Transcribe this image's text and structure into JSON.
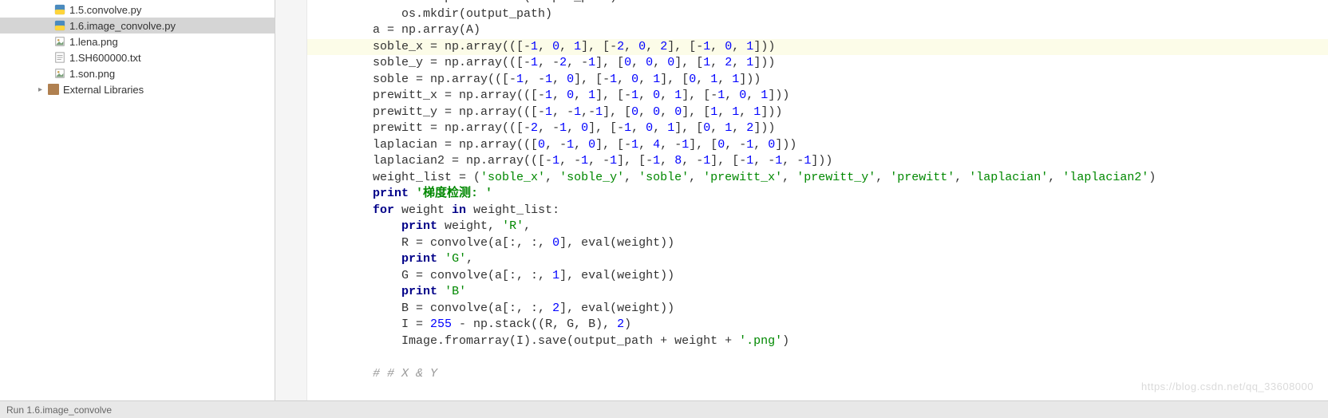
{
  "sidebar": {
    "files": [
      {
        "name": "1.5.convolve.py",
        "type": "py"
      },
      {
        "name": "1.6.image_convolve.py",
        "type": "py",
        "selected": true
      },
      {
        "name": "1.lena.png",
        "type": "img"
      },
      {
        "name": "1.SH600000.txt",
        "type": "txt"
      },
      {
        "name": "1.son.png",
        "type": "img"
      }
    ],
    "external_libraries_label": "External Libraries"
  },
  "code": {
    "lines": [
      {
        "indent": 2,
        "tokens": [
          {
            "t": "if",
            "c": "kw"
          },
          {
            "t": " "
          },
          {
            "t": "not",
            "c": "kw"
          },
          {
            "t": " os.path.exists(output_path):"
          }
        ],
        "cut_top": true
      },
      {
        "indent": 3,
        "tokens": [
          {
            "t": "os.mkdir(output_path)"
          }
        ]
      },
      {
        "indent": 2,
        "tokens": [
          {
            "t": "a = np.array(A)"
          }
        ]
      },
      {
        "indent": 2,
        "highlight": true,
        "tokens": [
          {
            "t": "soble_x = np.array(([-"
          },
          {
            "t": "1",
            "c": "num"
          },
          {
            "t": ", "
          },
          {
            "t": "0",
            "c": "num"
          },
          {
            "t": ", "
          },
          {
            "t": "1",
            "c": "num"
          },
          {
            "t": "], [-"
          },
          {
            "t": "2",
            "c": "num"
          },
          {
            "t": ", "
          },
          {
            "t": "0",
            "c": "num"
          },
          {
            "t": ", "
          },
          {
            "t": "2",
            "c": "num"
          },
          {
            "t": "], [-"
          },
          {
            "t": "1",
            "c": "num"
          },
          {
            "t": ", "
          },
          {
            "t": "0",
            "c": "num"
          },
          {
            "t": ", "
          },
          {
            "t": "1",
            "c": "num"
          },
          {
            "t": "]))"
          }
        ]
      },
      {
        "indent": 2,
        "tokens": [
          {
            "t": "soble_y = np.array(([-"
          },
          {
            "t": "1",
            "c": "num"
          },
          {
            "t": ", -"
          },
          {
            "t": "2",
            "c": "num"
          },
          {
            "t": ", -"
          },
          {
            "t": "1",
            "c": "num"
          },
          {
            "t": "], ["
          },
          {
            "t": "0",
            "c": "num"
          },
          {
            "t": ", "
          },
          {
            "t": "0",
            "c": "num"
          },
          {
            "t": ", "
          },
          {
            "t": "0",
            "c": "num"
          },
          {
            "t": "], ["
          },
          {
            "t": "1",
            "c": "num"
          },
          {
            "t": ", "
          },
          {
            "t": "2",
            "c": "num"
          },
          {
            "t": ", "
          },
          {
            "t": "1",
            "c": "num"
          },
          {
            "t": "]))"
          }
        ]
      },
      {
        "indent": 2,
        "tokens": [
          {
            "t": "soble = np.array(([-"
          },
          {
            "t": "1",
            "c": "num"
          },
          {
            "t": ", -"
          },
          {
            "t": "1",
            "c": "num"
          },
          {
            "t": ", "
          },
          {
            "t": "0",
            "c": "num"
          },
          {
            "t": "], [-"
          },
          {
            "t": "1",
            "c": "num"
          },
          {
            "t": ", "
          },
          {
            "t": "0",
            "c": "num"
          },
          {
            "t": ", "
          },
          {
            "t": "1",
            "c": "num"
          },
          {
            "t": "], ["
          },
          {
            "t": "0",
            "c": "num"
          },
          {
            "t": ", "
          },
          {
            "t": "1",
            "c": "num"
          },
          {
            "t": ", "
          },
          {
            "t": "1",
            "c": "num"
          },
          {
            "t": "]))"
          }
        ]
      },
      {
        "indent": 2,
        "tokens": [
          {
            "t": "prewitt_x = np.array(([-"
          },
          {
            "t": "1",
            "c": "num"
          },
          {
            "t": ", "
          },
          {
            "t": "0",
            "c": "num"
          },
          {
            "t": ", "
          },
          {
            "t": "1",
            "c": "num"
          },
          {
            "t": "], [-"
          },
          {
            "t": "1",
            "c": "num"
          },
          {
            "t": ", "
          },
          {
            "t": "0",
            "c": "num"
          },
          {
            "t": ", "
          },
          {
            "t": "1",
            "c": "num"
          },
          {
            "t": "], [-"
          },
          {
            "t": "1",
            "c": "num"
          },
          {
            "t": ", "
          },
          {
            "t": "0",
            "c": "num"
          },
          {
            "t": ", "
          },
          {
            "t": "1",
            "c": "num"
          },
          {
            "t": "]))"
          }
        ]
      },
      {
        "indent": 2,
        "tokens": [
          {
            "t": "prewitt_y = np.array(([-"
          },
          {
            "t": "1",
            "c": "num"
          },
          {
            "t": ", -"
          },
          {
            "t": "1",
            "c": "num"
          },
          {
            "t": ",-"
          },
          {
            "t": "1",
            "c": "num"
          },
          {
            "t": "], ["
          },
          {
            "t": "0",
            "c": "num"
          },
          {
            "t": ", "
          },
          {
            "t": "0",
            "c": "num"
          },
          {
            "t": ", "
          },
          {
            "t": "0",
            "c": "num"
          },
          {
            "t": "], ["
          },
          {
            "t": "1",
            "c": "num"
          },
          {
            "t": ", "
          },
          {
            "t": "1",
            "c": "num"
          },
          {
            "t": ", "
          },
          {
            "t": "1",
            "c": "num"
          },
          {
            "t": "]))"
          }
        ]
      },
      {
        "indent": 2,
        "tokens": [
          {
            "t": "prewitt = np.array(([-"
          },
          {
            "t": "2",
            "c": "num"
          },
          {
            "t": ", -"
          },
          {
            "t": "1",
            "c": "num"
          },
          {
            "t": ", "
          },
          {
            "t": "0",
            "c": "num"
          },
          {
            "t": "], [-"
          },
          {
            "t": "1",
            "c": "num"
          },
          {
            "t": ", "
          },
          {
            "t": "0",
            "c": "num"
          },
          {
            "t": ", "
          },
          {
            "t": "1",
            "c": "num"
          },
          {
            "t": "], ["
          },
          {
            "t": "0",
            "c": "num"
          },
          {
            "t": ", "
          },
          {
            "t": "1",
            "c": "num"
          },
          {
            "t": ", "
          },
          {
            "t": "2",
            "c": "num"
          },
          {
            "t": "]))"
          }
        ]
      },
      {
        "indent": 2,
        "tokens": [
          {
            "t": "laplacian = np.array((["
          },
          {
            "t": "0",
            "c": "num"
          },
          {
            "t": ", -"
          },
          {
            "t": "1",
            "c": "num"
          },
          {
            "t": ", "
          },
          {
            "t": "0",
            "c": "num"
          },
          {
            "t": "], [-"
          },
          {
            "t": "1",
            "c": "num"
          },
          {
            "t": ", "
          },
          {
            "t": "4",
            "c": "num"
          },
          {
            "t": ", -"
          },
          {
            "t": "1",
            "c": "num"
          },
          {
            "t": "], ["
          },
          {
            "t": "0",
            "c": "num"
          },
          {
            "t": ", -"
          },
          {
            "t": "1",
            "c": "num"
          },
          {
            "t": ", "
          },
          {
            "t": "0",
            "c": "num"
          },
          {
            "t": "]))"
          }
        ]
      },
      {
        "indent": 2,
        "tokens": [
          {
            "t": "laplacian2 = np.array(([-"
          },
          {
            "t": "1",
            "c": "num"
          },
          {
            "t": ", -"
          },
          {
            "t": "1",
            "c": "num"
          },
          {
            "t": ", -"
          },
          {
            "t": "1",
            "c": "num"
          },
          {
            "t": "], [-"
          },
          {
            "t": "1",
            "c": "num"
          },
          {
            "t": ", "
          },
          {
            "t": "8",
            "c": "num"
          },
          {
            "t": ", -"
          },
          {
            "t": "1",
            "c": "num"
          },
          {
            "t": "], [-"
          },
          {
            "t": "1",
            "c": "num"
          },
          {
            "t": ", -"
          },
          {
            "t": "1",
            "c": "num"
          },
          {
            "t": ", -"
          },
          {
            "t": "1",
            "c": "num"
          },
          {
            "t": "]))"
          }
        ]
      },
      {
        "indent": 2,
        "tokens": [
          {
            "t": "weight_list = ("
          },
          {
            "t": "'soble_x'",
            "c": "str"
          },
          {
            "t": ", "
          },
          {
            "t": "'soble_y'",
            "c": "str"
          },
          {
            "t": ", "
          },
          {
            "t": "'soble'",
            "c": "str"
          },
          {
            "t": ", "
          },
          {
            "t": "'prewitt_x'",
            "c": "str"
          },
          {
            "t": ", "
          },
          {
            "t": "'prewitt_y'",
            "c": "str"
          },
          {
            "t": ", "
          },
          {
            "t": "'prewitt'",
            "c": "str"
          },
          {
            "t": ", "
          },
          {
            "t": "'laplacian'",
            "c": "str"
          },
          {
            "t": ", "
          },
          {
            "t": "'laplacian2'",
            "c": "str"
          },
          {
            "t": ")"
          }
        ]
      },
      {
        "indent": 2,
        "tokens": [
          {
            "t": "print",
            "c": "kw"
          },
          {
            "t": " "
          },
          {
            "t": "'梯度检测: '",
            "c": "str-cjk"
          }
        ]
      },
      {
        "indent": 2,
        "tokens": [
          {
            "t": "for",
            "c": "kw"
          },
          {
            "t": " weight "
          },
          {
            "t": "in",
            "c": "kw"
          },
          {
            "t": " weight_list:"
          }
        ]
      },
      {
        "indent": 3,
        "tokens": [
          {
            "t": "print",
            "c": "kw"
          },
          {
            "t": " weight, "
          },
          {
            "t": "'R'",
            "c": "str"
          },
          {
            "t": ","
          }
        ]
      },
      {
        "indent": 3,
        "tokens": [
          {
            "t": "R = convolve(a[:, :, "
          },
          {
            "t": "0",
            "c": "num"
          },
          {
            "t": "], eval(weight))"
          }
        ]
      },
      {
        "indent": 3,
        "tokens": [
          {
            "t": "print",
            "c": "kw"
          },
          {
            "t": " "
          },
          {
            "t": "'G'",
            "c": "str"
          },
          {
            "t": ","
          }
        ]
      },
      {
        "indent": 3,
        "tokens": [
          {
            "t": "G = convolve(a[:, :, "
          },
          {
            "t": "1",
            "c": "num"
          },
          {
            "t": "], eval(weight))"
          }
        ]
      },
      {
        "indent": 3,
        "tokens": [
          {
            "t": "print",
            "c": "kw"
          },
          {
            "t": " "
          },
          {
            "t": "'B'",
            "c": "str"
          }
        ]
      },
      {
        "indent": 3,
        "tokens": [
          {
            "t": "B = convolve(a[:, :, "
          },
          {
            "t": "2",
            "c": "num"
          },
          {
            "t": "], eval(weight))"
          }
        ]
      },
      {
        "indent": 3,
        "tokens": [
          {
            "t": "I = "
          },
          {
            "t": "255",
            "c": "num"
          },
          {
            "t": " - np.stack((R, G, B), "
          },
          {
            "t": "2",
            "c": "num"
          },
          {
            "t": ")"
          }
        ]
      },
      {
        "indent": 3,
        "tokens": [
          {
            "t": "Image.fromarray(I).save(output_path + weight + "
          },
          {
            "t": "'.png'",
            "c": "str"
          },
          {
            "t": ")"
          }
        ]
      },
      {
        "indent": 0,
        "tokens": [
          {
            "t": ""
          }
        ]
      },
      {
        "indent": 2,
        "tokens": [
          {
            "t": "# # X & Y",
            "c": "cmt"
          }
        ]
      }
    ]
  },
  "statusbar": {
    "text": "Run  1.6.image_convolve"
  },
  "watermark": "https://blog.csdn.net/qq_33608000"
}
